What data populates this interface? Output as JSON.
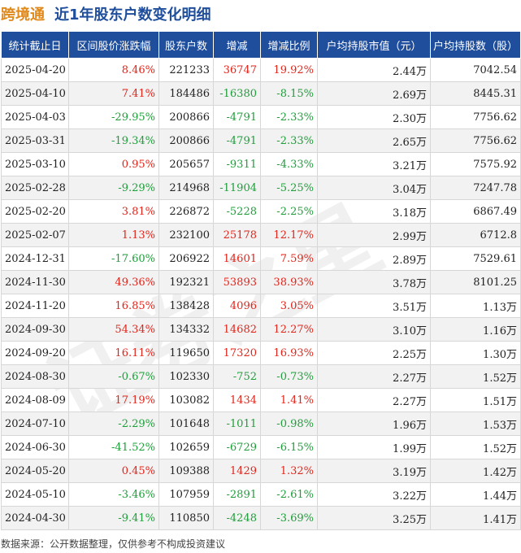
{
  "header": {
    "stock_name": "跨境通",
    "subtitle": "近1年股东户数变化明细"
  },
  "chart_data": {
    "type": "table",
    "columns": [
      "统计截止日",
      "区间股价涨跌幅",
      "股东户数",
      "增减",
      "增减比例",
      "户均持股市值（元）",
      "户均持股数（股）"
    ],
    "rows": [
      [
        "2025-04-20",
        "8.46%",
        "221233",
        "36747",
        "19.92%",
        "2.44万",
        "7042.54"
      ],
      [
        "2025-04-10",
        "7.41%",
        "184486",
        "-16380",
        "-8.15%",
        "2.69万",
        "8445.31"
      ],
      [
        "2025-04-03",
        "-29.95%",
        "200866",
        "-4791",
        "-2.33%",
        "2.30万",
        "7756.62"
      ],
      [
        "2025-03-31",
        "-19.34%",
        "200866",
        "-4791",
        "-2.33%",
        "2.65万",
        "7756.62"
      ],
      [
        "2025-03-10",
        "0.95%",
        "205657",
        "-9311",
        "-4.33%",
        "3.21万",
        "7575.92"
      ],
      [
        "2025-02-28",
        "-9.29%",
        "214968",
        "-11904",
        "-5.25%",
        "3.04万",
        "7247.78"
      ],
      [
        "2025-02-20",
        "3.81%",
        "226872",
        "-5228",
        "-2.25%",
        "3.18万",
        "6867.49"
      ],
      [
        "2025-02-07",
        "1.13%",
        "232100",
        "25178",
        "12.17%",
        "2.99万",
        "6712.8"
      ],
      [
        "2024-12-31",
        "-17.60%",
        "206922",
        "14601",
        "7.59%",
        "2.89万",
        "7529.61"
      ],
      [
        "2024-11-30",
        "49.36%",
        "192321",
        "53893",
        "38.93%",
        "3.78万",
        "8101.25"
      ],
      [
        "2024-11-20",
        "16.85%",
        "138428",
        "4096",
        "3.05%",
        "3.51万",
        "1.13万"
      ],
      [
        "2024-09-30",
        "54.34%",
        "134332",
        "14682",
        "12.27%",
        "3.10万",
        "1.16万"
      ],
      [
        "2024-09-20",
        "16.11%",
        "119650",
        "17320",
        "16.93%",
        "2.25万",
        "1.30万"
      ],
      [
        "2024-08-30",
        "-0.67%",
        "102330",
        "-752",
        "-0.73%",
        "2.27万",
        "1.52万"
      ],
      [
        "2024-08-09",
        "17.19%",
        "103082",
        "1434",
        "1.41%",
        "2.27万",
        "1.51万"
      ],
      [
        "2024-07-10",
        "-2.29%",
        "101648",
        "-1011",
        "-0.98%",
        "1.96万",
        "1.53万"
      ],
      [
        "2024-06-30",
        "-41.52%",
        "102659",
        "-6729",
        "-6.15%",
        "1.99万",
        "1.52万"
      ],
      [
        "2024-05-20",
        "0.45%",
        "109388",
        "1429",
        "1.32%",
        "3.19万",
        "1.42万"
      ],
      [
        "2024-05-10",
        "-3.46%",
        "107959",
        "-2891",
        "-2.61%",
        "3.22万",
        "1.44万"
      ],
      [
        "2024-04-30",
        "-9.41%",
        "110850",
        "-4248",
        "-3.69%",
        "3.25万",
        "1.41万"
      ]
    ]
  },
  "colors": {
    "header_bg": "#1f4e9c",
    "stock_name": "#e08a1e",
    "positive": "#e1251b",
    "negative": "#1f9e3a",
    "alt_row": "#f2f2f2"
  },
  "footer": {
    "source": "数据来源：公开数据整理，仅供参考不构成投资建议"
  },
  "watermark": {
    "text": "证券之星"
  }
}
